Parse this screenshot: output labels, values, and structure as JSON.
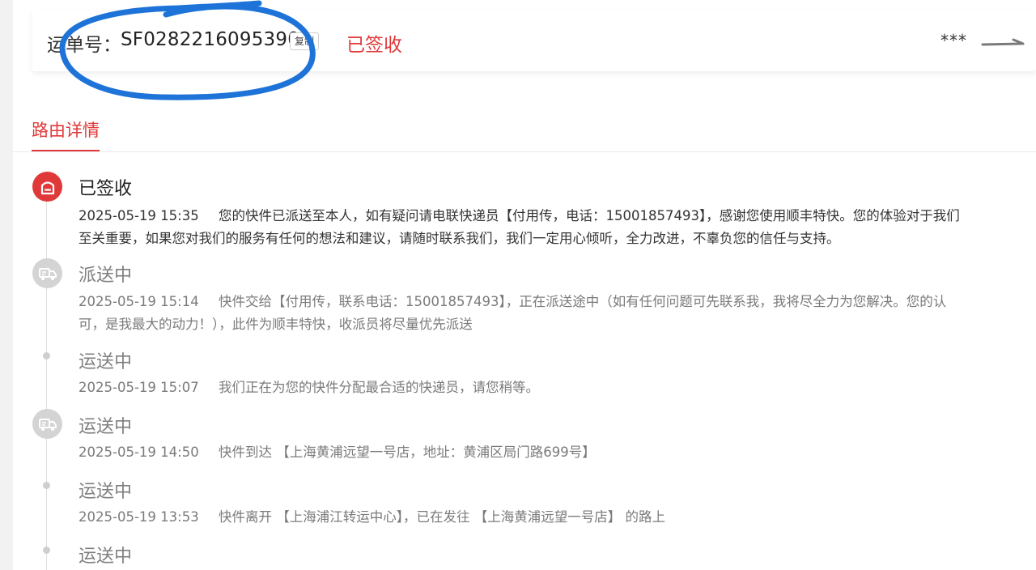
{
  "header": {
    "waybill_label": "运单号：",
    "waybill_number": "SF0282216095390",
    "copy_label": "复制",
    "status": "已签收",
    "masked_name": "***"
  },
  "tabs": {
    "active_label": "路由详情"
  },
  "events": [
    {
      "title": "已签收",
      "time": "2025-05-19 15:35",
      "desc": "您的快件已派送至本人，如有疑问请电联快递员【付用传，电话：15001857493】，感谢您使用顺丰特快。您的体验对于我们至关重要，如果您对我们的服务有任何的想法和建议，请随时联系我们，我们一定用心倾听，全力改进，不辜负您的信任与支持。",
      "icon": "signed-box-icon"
    },
    {
      "title": "派送中",
      "time": "2025-05-19 15:14",
      "desc": "快件交给【付用传，联系电话：15001857493】，正在派送途中（如有任何问题可先联系我，我将尽全力为您解决。您的认可，是我最大的动力！），此件为顺丰特快，收派员将尽量优先派送",
      "icon": "delivery-truck-icon"
    },
    {
      "title": "运送中",
      "time": "2025-05-19 15:07",
      "desc": "我们正在为您的快件分配最合适的快递员，请您稍等。",
      "icon": "dot"
    },
    {
      "title": "运送中",
      "time": "2025-05-19 14:50",
      "desc": "快件到达 【上海黄浦远望一号店，地址：黄浦区局门路699号】",
      "icon": "delivery-truck-icon"
    },
    {
      "title": "运送中",
      "time": "2025-05-19 13:53",
      "desc": "快件离开 【上海浦江转运中心】，已在发往 【上海黄浦远望一号店】 的路上",
      "icon": "dot"
    },
    {
      "title": "运送中",
      "icon": "dot"
    }
  ],
  "colors": {
    "accent": "#e0393a",
    "annotation": "#1e73d8",
    "muted": "#7a7a7a"
  }
}
